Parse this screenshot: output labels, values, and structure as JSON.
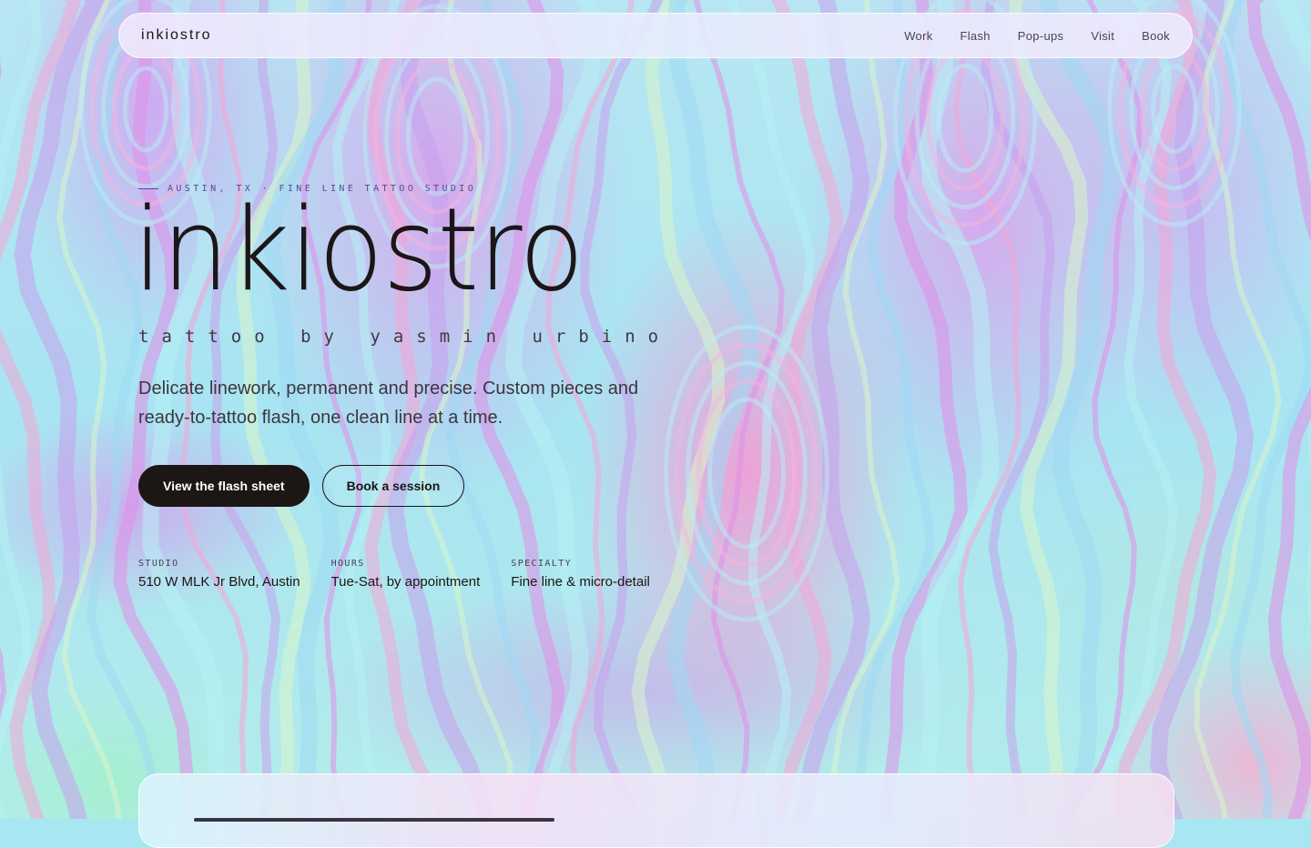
{
  "nav": {
    "logo": "inkiostro",
    "links": [
      "Work",
      "Flash",
      "Pop-ups",
      "Visit",
      "Book"
    ]
  },
  "hero": {
    "eyebrow": "AUSTIN, TX · FINE LINE TATTOO STUDIO",
    "title": "inkiostro",
    "tagline": "tattoo by yasmin urbino",
    "lede": "Delicate linework, permanent and precise. Custom pieces and ready-to-tattoo flash, one clean line at a time.",
    "cta_primary": "View the flash sheet",
    "cta_secondary": "Book a session"
  },
  "facts": [
    {
      "label": "STUDIO",
      "value": "510 W MLK Jr Blvd, Austin"
    },
    {
      "label": "HOURS",
      "value": "Tue-Sat, by appointment"
    },
    {
      "label": "SPECIALTY",
      "value": "Fine line & micro-detail"
    }
  ],
  "colors": {
    "ink": "#1c1614",
    "eyebrow": "#514c92",
    "marble_pink": "#e296ec",
    "marble_cyan": "#a8e4f2"
  }
}
